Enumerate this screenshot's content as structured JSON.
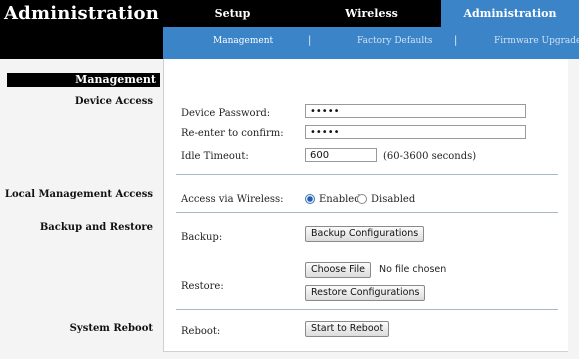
{
  "header": {
    "title": "Administration",
    "tabs": [
      {
        "label": "Setup",
        "active": false
      },
      {
        "label": "Wireless",
        "active": false
      },
      {
        "label": "Administration",
        "active": true
      }
    ],
    "subtabs": [
      {
        "label": "Management",
        "active": true
      },
      {
        "label": "Factory Defaults",
        "active": false
      },
      {
        "label": "Firmware Upgrade",
        "active": false
      }
    ],
    "separator": "|"
  },
  "sidebar": {
    "active_section": "Management",
    "sections": {
      "device_access": "Device Access",
      "local_management_access": "Local Management Access",
      "backup_and_restore": "Backup and Restore",
      "system_reboot": "System Reboot"
    }
  },
  "device_access": {
    "password_label": "Device Password:",
    "password_value": "•••••",
    "confirm_label": "Re-enter to confirm:",
    "confirm_value": "•••••",
    "idle_label": "Idle Timeout:",
    "idle_value": "600",
    "idle_hint": "(60-3600 seconds)"
  },
  "local_management": {
    "label": "Access via Wireless:",
    "enabled_label": "Enabled",
    "disabled_label": "Disabled",
    "selected": "Enabled"
  },
  "backup_restore": {
    "backup_label": "Backup:",
    "backup_button": "Backup Configurations",
    "restore_label": "Restore:",
    "choose_file_button": "Choose File",
    "file_status": "No file chosen",
    "restore_button": "Restore Configurations"
  },
  "system_reboot": {
    "label": "Reboot:",
    "button": "Start to Reboot"
  },
  "colors": {
    "header_bg": "#000000",
    "accent_blue": "#3b84c8",
    "panel_bg": "#ffffff",
    "page_bg": "#f4f4f4"
  }
}
